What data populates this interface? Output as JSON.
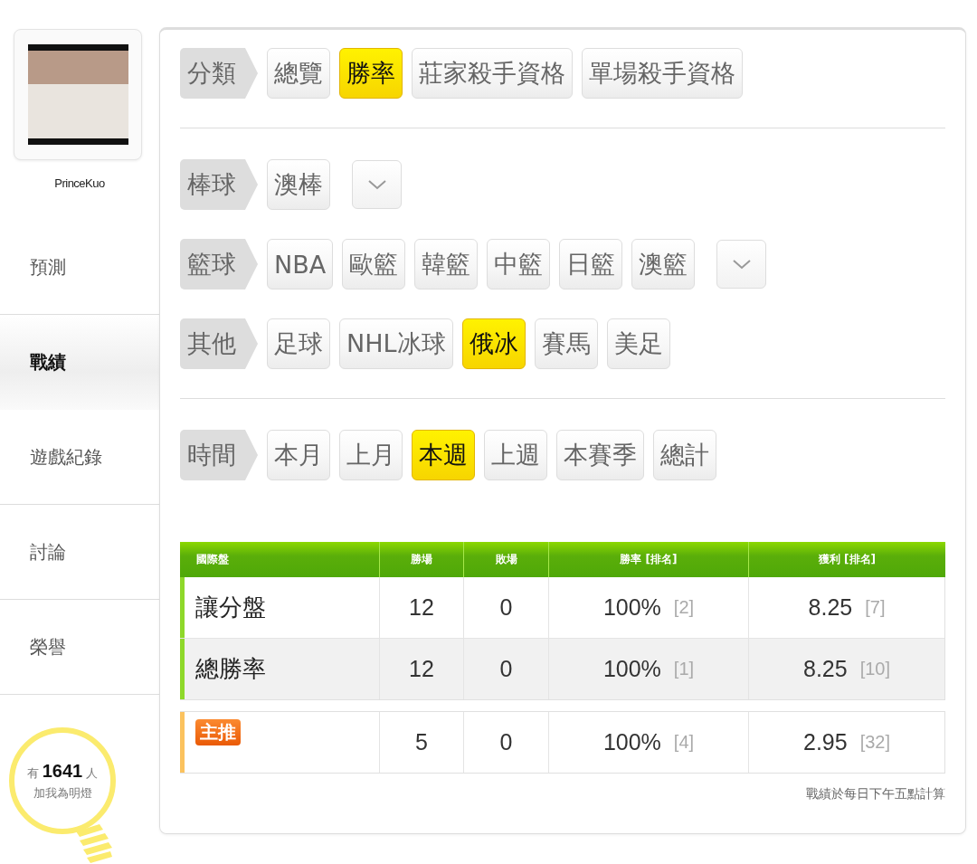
{
  "profile": {
    "name": "PrinceKuo"
  },
  "nav": [
    {
      "label": "預測",
      "selected": false
    },
    {
      "label": "戰績",
      "selected": true
    },
    {
      "label": "遊戲紀錄",
      "selected": false
    },
    {
      "label": "討論",
      "selected": false
    },
    {
      "label": "榮譽",
      "selected": false
    }
  ],
  "fans": {
    "prefix": "有",
    "count": "1641",
    "suffix": "人",
    "caption": "加我為明燈"
  },
  "filter_sections": [
    {
      "rows": [
        {
          "label": "分類",
          "options": [
            {
              "label": "總覽",
              "selected": false
            },
            {
              "label": "勝率",
              "selected": true
            },
            {
              "label": "莊家殺手資格",
              "selected": false
            },
            {
              "label": "單場殺手資格",
              "selected": false
            }
          ]
        }
      ]
    },
    {
      "rows": [
        {
          "label": "棒球",
          "dropdown": true,
          "options": [
            {
              "label": "澳棒",
              "selected": false
            }
          ]
        },
        {
          "label": "籃球",
          "dropdown": true,
          "options": [
            {
              "label": "NBA",
              "selected": false
            },
            {
              "label": "歐籃",
              "selected": false
            },
            {
              "label": "韓籃",
              "selected": false
            },
            {
              "label": "中籃",
              "selected": false
            },
            {
              "label": "日籃",
              "selected": false
            },
            {
              "label": "澳籃",
              "selected": false
            }
          ]
        },
        {
          "label": "其他",
          "options": [
            {
              "label": "足球",
              "selected": false
            },
            {
              "label": "NHL冰球",
              "selected": false
            },
            {
              "label": "俄冰",
              "selected": true
            },
            {
              "label": "賽馬",
              "selected": false
            },
            {
              "label": "美足",
              "selected": false
            }
          ]
        }
      ]
    },
    {
      "rows": [
        {
          "label": "時間",
          "options": [
            {
              "label": "本月",
              "selected": false
            },
            {
              "label": "上月",
              "selected": false
            },
            {
              "label": "本週",
              "selected": true
            },
            {
              "label": "上週",
              "selected": false
            },
            {
              "label": "本賽季",
              "selected": false
            },
            {
              "label": "總計",
              "selected": false
            }
          ]
        }
      ]
    }
  ],
  "table": {
    "columns": [
      "國際盤",
      "勝場",
      "敗場",
      "勝率 [排名]",
      "獲利 [排名]"
    ],
    "groups": [
      [
        {
          "kind": "text",
          "color": "#8ed82a",
          "label": "讓分盤",
          "wins": "12",
          "losses": "0",
          "win_rate": "100%",
          "win_rate_rank": "[2]",
          "profit": "8.25",
          "profit_rank": "[7]"
        },
        {
          "kind": "text",
          "color": "#8ed82a",
          "label": "總勝率",
          "wins": "12",
          "losses": "0",
          "win_rate": "100%",
          "win_rate_rank": "[1]",
          "profit": "8.25",
          "profit_rank": "[10]"
        }
      ],
      [
        {
          "kind": "badge",
          "color": "#fbc25e",
          "label": "主推",
          "wins": "5",
          "losses": "0",
          "win_rate": "100%",
          "win_rate_rank": "[4]",
          "profit": "2.95",
          "profit_rank": "[32]"
        }
      ]
    ]
  },
  "footnote": "戰績於每日下午五點計算"
}
